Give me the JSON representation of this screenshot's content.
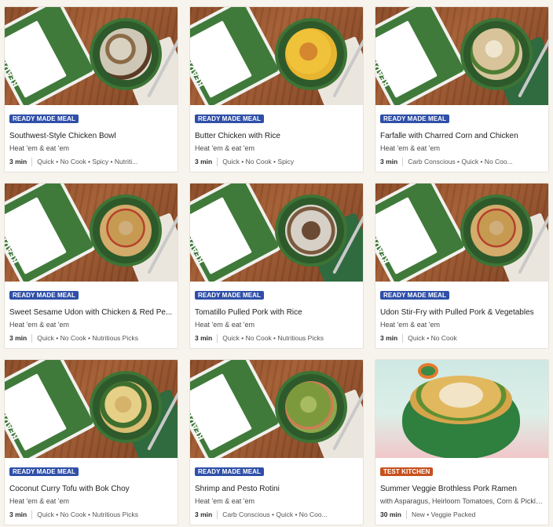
{
  "cards": [
    {
      "badge": "READY MADE MEAL",
      "title": "Southwest-Style Chicken Bowl",
      "subtitle": "Heat 'em & eat 'em",
      "time": "3 min",
      "tags": "Quick • No Cook • Spicy • Nutriti..."
    },
    {
      "badge": "READY MADE MEAL",
      "title": "Butter Chicken with Rice",
      "subtitle": "Heat 'em & eat 'em",
      "time": "3 min",
      "tags": "Quick • No Cook • Spicy"
    },
    {
      "badge": "READY MADE MEAL",
      "title": "Farfalle with Charred Corn and Chicken",
      "subtitle": "Heat 'em & eat 'em",
      "time": "3 min",
      "tags": "Carb Conscious • Quick • No Coo..."
    },
    {
      "badge": "READY MADE MEAL",
      "title": "Sweet Sesame Udon with Chicken & Red Pe...",
      "subtitle": "Heat 'em & eat 'em",
      "time": "3 min",
      "tags": "Quick • No Cook • Nutritious Picks"
    },
    {
      "badge": "READY MADE MEAL",
      "title": "Tomatillo Pulled Pork with Rice",
      "subtitle": "Heat 'em & eat 'em",
      "time": "3 min",
      "tags": "Quick • No Cook • Nutritious Picks"
    },
    {
      "badge": "READY MADE MEAL",
      "title": "Udon Stir-Fry with Pulled Pork & Vegetables",
      "subtitle": "Heat 'em & eat 'em",
      "time": "3 min",
      "tags": "Quick • No Cook"
    },
    {
      "badge": "READY MADE MEAL",
      "title": "Coconut Curry Tofu with Bok Choy",
      "subtitle": "Heat 'em & eat 'em",
      "time": "3 min",
      "tags": "Quick • No Cook • Nutritious Picks"
    },
    {
      "badge": "READY MADE MEAL",
      "title": "Shrimp and Pesto Rotini",
      "subtitle": "Heat 'em & eat 'em",
      "time": "3 min",
      "tags": "Carb Conscious • Quick • No Coo..."
    },
    {
      "badge": "TEST KITCHEN",
      "title": "Summer Veggie Brothless Pork Ramen",
      "subtitle": "with Asparagus, Heirloom Tomatoes, Corn & Pickled...",
      "time": "30 min",
      "tags": "New • Veggie Packed"
    }
  ],
  "package_label": "READY MADE MEALS",
  "colors": {
    "badge_blue": "#2f4fa8",
    "badge_orange": "#c7511f",
    "package_green": "#3f7a3a"
  }
}
